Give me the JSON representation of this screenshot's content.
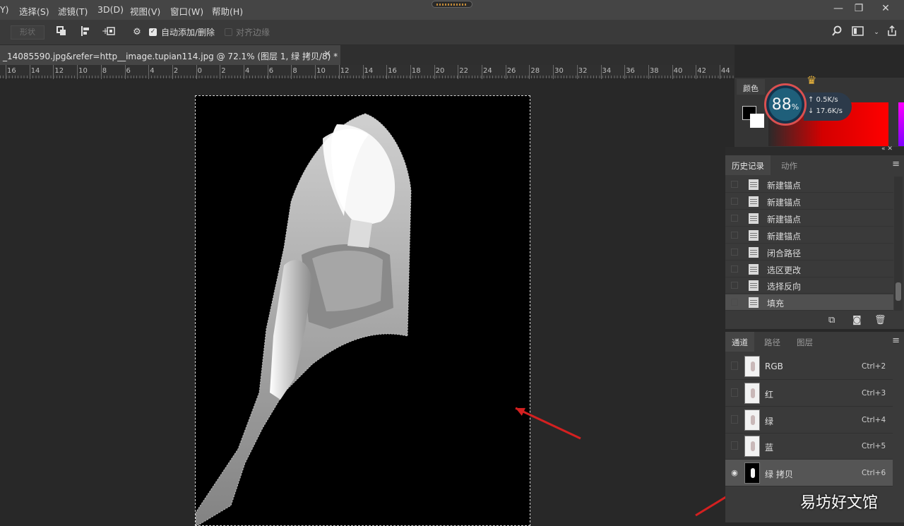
{
  "menu": {
    "items": [
      {
        "label": "Y)"
      },
      {
        "label": "选择(S)"
      },
      {
        "label": "滤镜(T)"
      },
      {
        "label": "3D(D)"
      },
      {
        "label": "视图(V)"
      },
      {
        "label": "窗口(W)"
      },
      {
        "label": "帮助(H)"
      }
    ],
    "window_controls": {
      "minimize": "—",
      "restore": "❐",
      "close": "✕"
    }
  },
  "options_bar": {
    "shape_field": "形状",
    "auto_add_delete": "自动添加/删除",
    "auto_add_checked": true,
    "align_edges": "对齐边缘",
    "align_edges_checked": false,
    "icons": [
      "path-operations-icon",
      "path-alignment-icon",
      "path-arrangement-icon",
      "gear-icon",
      "search-icon",
      "workspace-icon",
      "share-icon"
    ]
  },
  "document_tab": {
    "title": "_14085590.jpg&refer=http__image.tupian114.jpg  @  72.1% (图层 1, 绿 拷贝/8) *",
    "close": "×"
  },
  "ruler": {
    "ticks": [
      "16",
      "14",
      "12",
      "10",
      "8",
      "6",
      "4",
      "2",
      "0",
      "2",
      "4",
      "6",
      "8",
      "10",
      "12",
      "14",
      "16",
      "18",
      "20",
      "22",
      "24",
      "26",
      "28",
      "30",
      "32",
      "34",
      "36",
      "38",
      "40",
      "42",
      "44"
    ]
  },
  "color_panel": {
    "tab": "颜色",
    "foreground": "#000000",
    "background": "#ffffff"
  },
  "speed_widget": {
    "percent": "88",
    "percent_sign": "%",
    "upload": "↑ 0.5K/s",
    "download": "↓ 17.6K/s"
  },
  "history_panel": {
    "tabs": [
      {
        "label": "历史记录",
        "active": true
      },
      {
        "label": "动作",
        "active": false
      }
    ],
    "items": [
      {
        "label": "新建锚点",
        "selected": false
      },
      {
        "label": "新建锚点",
        "selected": false
      },
      {
        "label": "新建锚点",
        "selected": false
      },
      {
        "label": "新建锚点",
        "selected": false
      },
      {
        "label": "闭合路径",
        "selected": false
      },
      {
        "label": "选区更改",
        "selected": false
      },
      {
        "label": "选择反向",
        "selected": false
      },
      {
        "label": "填充",
        "selected": true
      }
    ]
  },
  "channels_panel": {
    "tabs": [
      {
        "label": "通道",
        "active": true
      },
      {
        "label": "路径",
        "active": false
      },
      {
        "label": "图层",
        "active": false
      }
    ],
    "channels": [
      {
        "name": "RGB",
        "shortcut": "Ctrl+2",
        "visible": false,
        "selected": false
      },
      {
        "name": "红",
        "shortcut": "Ctrl+3",
        "visible": false,
        "selected": false
      },
      {
        "name": "绿",
        "shortcut": "Ctrl+4",
        "visible": false,
        "selected": false
      },
      {
        "name": "蓝",
        "shortcut": "Ctrl+5",
        "visible": false,
        "selected": false
      },
      {
        "name": "绿 拷贝",
        "shortcut": "Ctrl+6",
        "visible": true,
        "selected": true
      }
    ]
  },
  "annotations": {
    "arrow_color": "#d42020"
  },
  "watermark": "易坊好文馆"
}
